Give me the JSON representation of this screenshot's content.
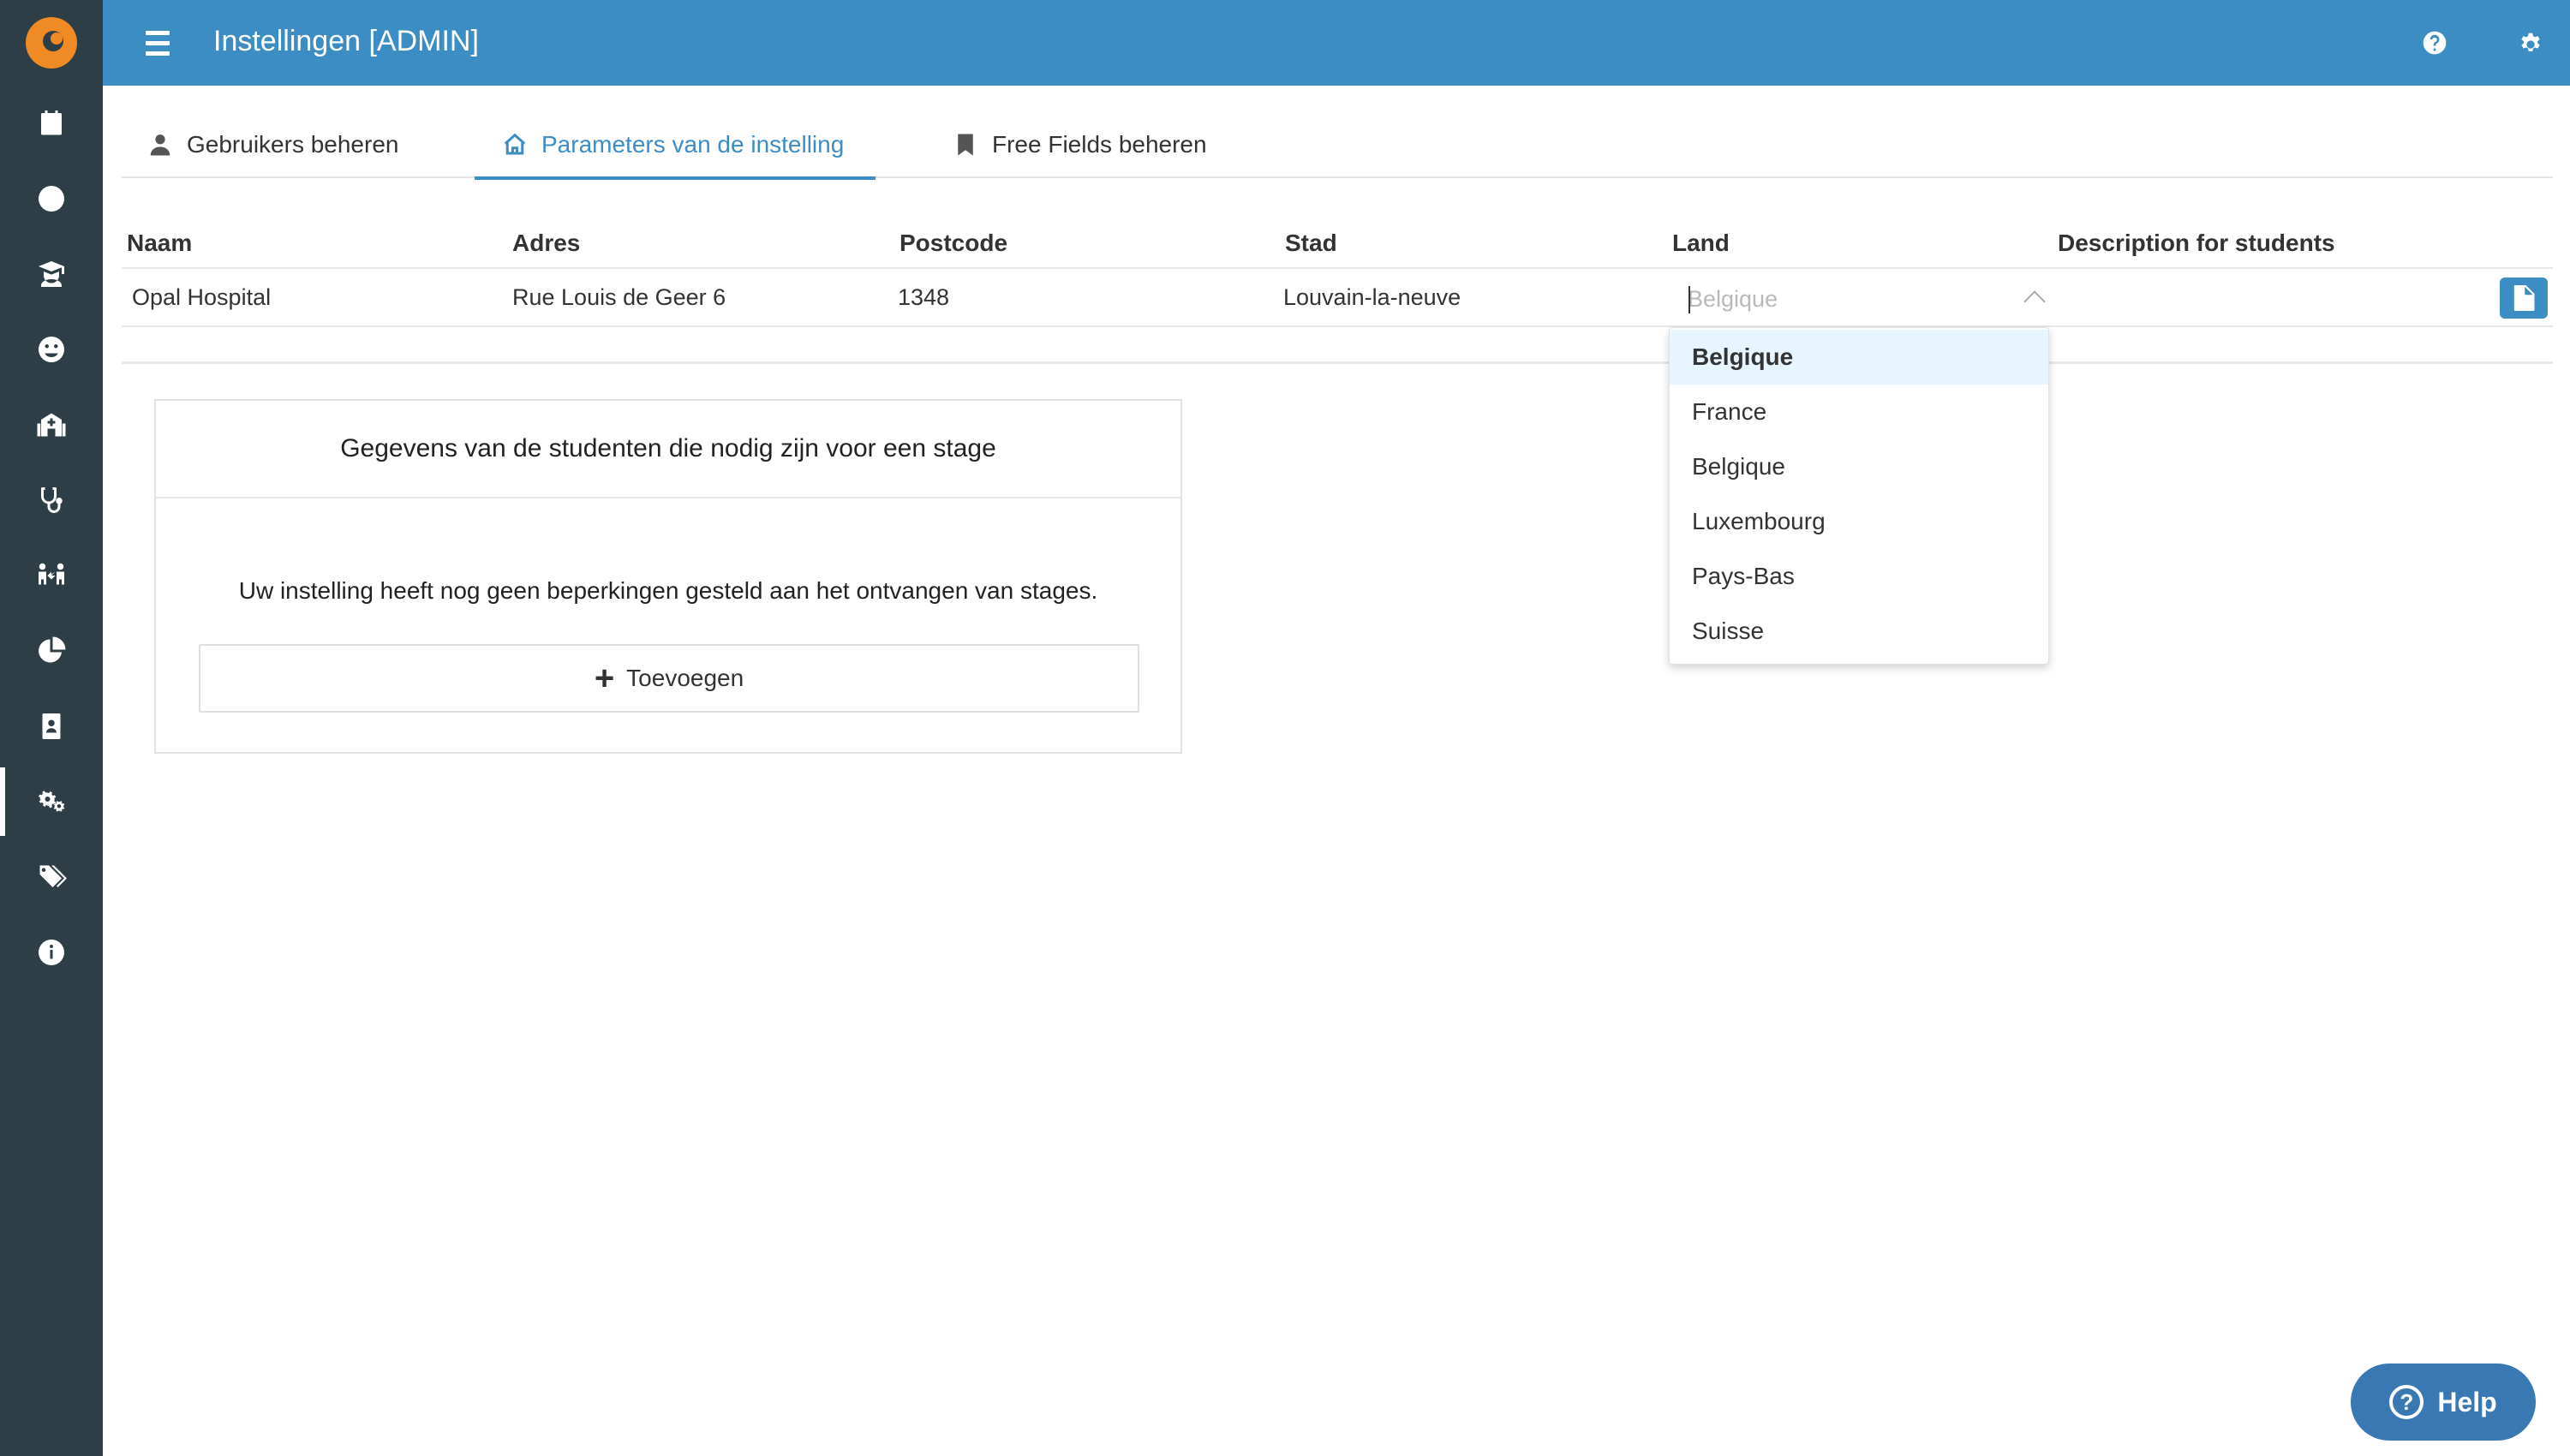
{
  "app": {
    "title": "Instellingen [ADMIN]"
  },
  "sidebar": {
    "items": [
      {
        "icon": "calendar-icon"
      },
      {
        "icon": "clock-icon"
      },
      {
        "icon": "graduate-icon"
      },
      {
        "icon": "smile-icon"
      },
      {
        "icon": "institution-icon"
      },
      {
        "icon": "stethoscope-icon"
      },
      {
        "icon": "people-arrows-icon"
      },
      {
        "icon": "pie-chart-icon"
      },
      {
        "icon": "contact-card-icon"
      },
      {
        "icon": "gears-icon",
        "active": true
      },
      {
        "icon": "tags-icon"
      },
      {
        "icon": "info-icon"
      }
    ]
  },
  "tabs": [
    {
      "label": "Gebruikers beheren",
      "icon": "user-icon"
    },
    {
      "label": "Parameters van de instelling",
      "icon": "home-icon",
      "active": true
    },
    {
      "label": "Free Fields beheren",
      "icon": "bookmark-icon"
    }
  ],
  "grid": {
    "columns": [
      "Naam",
      "Adres",
      "Postcode",
      "Stad",
      "Land",
      "Description for students"
    ],
    "row": {
      "naam": "Opal Hospital",
      "adres": "Rue Louis de Geer 6",
      "postcode": "1348",
      "stad": "Louvain-la-neuve",
      "land_placeholder": "Belgique",
      "description": ""
    }
  },
  "land_dropdown": {
    "options": [
      "Belgique",
      "France",
      "Belgique",
      "Luxembourg",
      "Pays-Bas",
      "Suisse"
    ],
    "highlighted": 0
  },
  "card": {
    "title": "Gegevens van de studenten die nodig zijn voor een stage",
    "message": "Uw instelling heeft nog geen beperkingen gesteld aan het ontvangen van stages.",
    "add_label": "Toevoegen"
  },
  "help": {
    "label": "Help"
  },
  "colors": {
    "topbar": "#3b8dc3",
    "sidebar": "#2d3e46",
    "accent": "#3b8dc3",
    "dropdown_highlight": "#e6f5ff"
  }
}
